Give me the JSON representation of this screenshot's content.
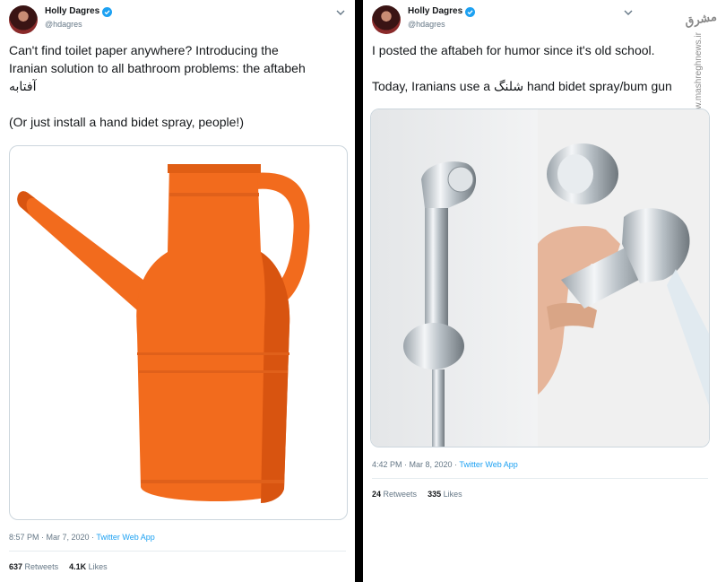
{
  "left": {
    "author": {
      "name": "Holly Dagres",
      "handle": "@hdagres"
    },
    "text": "Can't find toilet paper anywhere? Introducing the\nIranian solution to all bathroom problems: the aftabeh\nآفتابه\n\n(Or just install a hand bidet spray, people!)",
    "timestamp": "8:57 PM · Mar 7, 2020 · ",
    "app": "Twitter Web App",
    "retweets": "637",
    "retweets_label": "Retweets",
    "likes": "4.1K",
    "likes_label": "Likes",
    "colors": {
      "jug": "#f26b1d",
      "jug_dark": "#d85410"
    }
  },
  "right": {
    "author": {
      "name": "Holly Dagres",
      "handle": "@hdagres"
    },
    "text": "I posted the aftabeh for humor since it's old school.\n\nToday, Iranians use a شلنگ hand bidet spray/bum gun",
    "timestamp": "4:42 PM · Mar 8, 2020 · ",
    "app": "Twitter Web App",
    "retweets": "24",
    "retweets_label": "Retweets",
    "likes": "335",
    "likes_label": "Likes",
    "watermark": "www.mashreghnews.ir",
    "watermark_logo": "مشرق"
  },
  "icons": {
    "verified": "verified-badge-icon",
    "caret": "chevron-down-icon"
  }
}
